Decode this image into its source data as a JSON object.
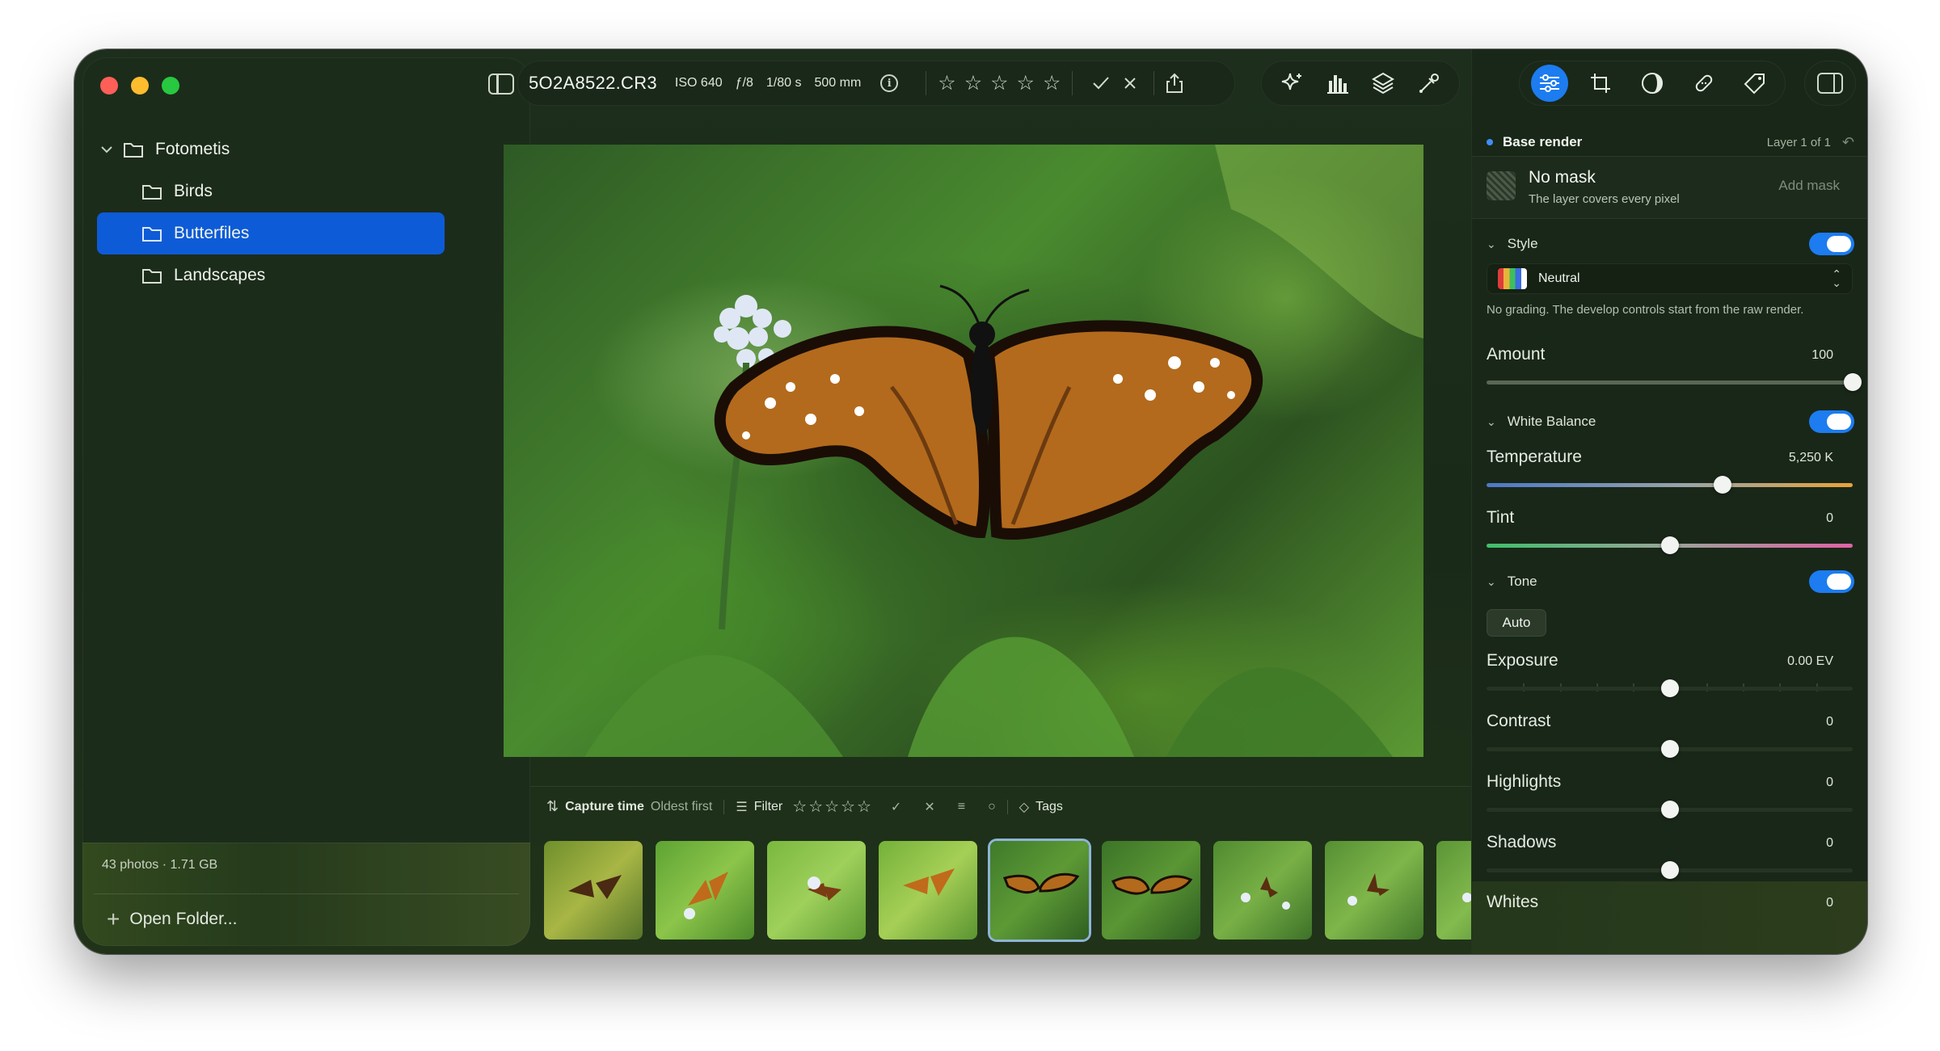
{
  "sidebar": {
    "traffic_lights": {
      "close": "#fe5f57",
      "minimize": "#febc2e",
      "zoom": "#28c840"
    },
    "tree": [
      {
        "label": "Fotometis",
        "level": "root",
        "selected": false
      },
      {
        "label": "Birds",
        "level": "child",
        "selected": false
      },
      {
        "label": "Butterfiles",
        "level": "child",
        "selected": true
      },
      {
        "label": "Landscapes",
        "level": "child",
        "selected": false
      }
    ],
    "stats": "43 photos · 1.71 GB",
    "open_folder": "Open Folder..."
  },
  "toolbar": {
    "filename": "5O2A8522.CR3",
    "iso": "ISO 640",
    "aperture": "ƒ/8",
    "shutter": "1/80 s",
    "focal": "500 mm",
    "rating": 0,
    "tools": [
      "sparkle-icon",
      "histogram-icon",
      "layers-icon",
      "eyedropper-icon"
    ]
  },
  "filterbar": {
    "sort_label": "Capture time",
    "sort_order": "Oldest first",
    "filter_label": "Filter",
    "tags_label": "Tags"
  },
  "filmstrip": {
    "count": 9,
    "selected_index": 4
  },
  "panel": {
    "tabs": [
      "adjust-icon",
      "crop-icon",
      "color-icon",
      "heal-icon",
      "tag-icon"
    ],
    "active_tab": 0,
    "layer": {
      "name": "Base render",
      "count": "Layer 1 of 1"
    },
    "mask": {
      "title": "No mask",
      "subtitle": "The layer covers every pixel",
      "add": "Add mask"
    },
    "style": {
      "heading": "Style",
      "enabled": true,
      "preset": "Neutral",
      "description": "No grading. The develop controls start from the raw render.",
      "amount_label": "Amount",
      "amount_value": "100",
      "amount": 100
    },
    "white_balance": {
      "heading": "White Balance",
      "enabled": true,
      "temperature_label": "Temperature",
      "temperature_value": "5,250 K",
      "temperature_fraction": 0.645,
      "tint_label": "Tint",
      "tint_value": "0",
      "tint_fraction": 0.5
    },
    "tone": {
      "heading": "Tone",
      "enabled": true,
      "auto_label": "Auto",
      "exposure_label": "Exposure",
      "exposure_value": "0.00 EV",
      "contrast_label": "Contrast",
      "contrast_value": "0",
      "highlights_label": "Highlights",
      "highlights_value": "0",
      "shadows_label": "Shadows",
      "shadows_value": "0",
      "whites_label": "Whites",
      "whites_value": "0"
    }
  }
}
